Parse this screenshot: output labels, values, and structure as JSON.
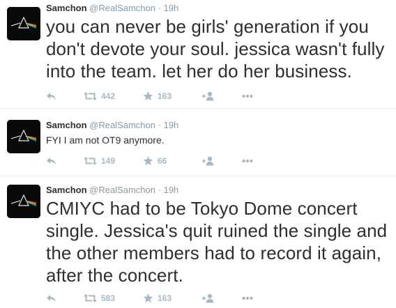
{
  "tweets": [
    {
      "name": "Samchon",
      "handle": "@RealSamchon",
      "separator": "·",
      "time": "19h",
      "text": "you can never be girls' generation if you don't devote your soul. jessica wasn't fully into the team. let her do her business.",
      "retweets": "442",
      "favorites": "163"
    },
    {
      "name": "Samchon",
      "handle": "@RealSamchon",
      "separator": "·",
      "time": "19h",
      "text": "FYI I am not OT9 anymore.",
      "retweets": "149",
      "favorites": "66"
    },
    {
      "name": "Samchon",
      "handle": "@RealSamchon",
      "separator": "·",
      "time": "19h",
      "text": "CMIYC had to be Tokyo Dome concert single. Jessica's quit ruined the single and the other members had to record it again, after the concert.",
      "retweets": "583",
      "favorites": "163"
    }
  ],
  "colors": {
    "name": "#292f33",
    "meta": "#8899a6",
    "action": "#aab8c2",
    "divider": "#e8ecee"
  },
  "icons": {
    "avatar": "prism-avatar",
    "reply": "reply-icon",
    "retweet": "retweet-icon",
    "favorite": "star-icon",
    "follow": "follow-icon",
    "more": "more-icon"
  }
}
